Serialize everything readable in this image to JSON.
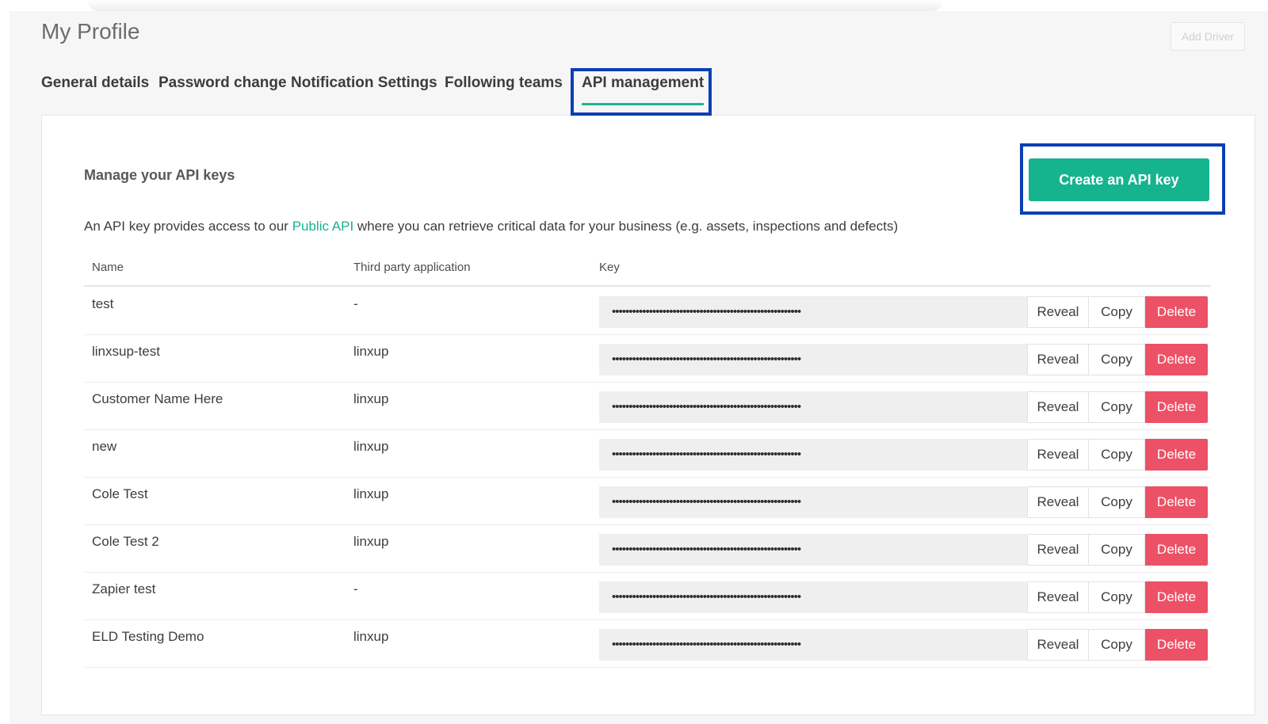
{
  "page": {
    "title": "My Profile",
    "add_driver_label": "Add Driver"
  },
  "tabs": [
    {
      "label": "General details"
    },
    {
      "label": "Password change"
    },
    {
      "label": "Notification Settings"
    },
    {
      "label": "Following teams"
    },
    {
      "label": "API management",
      "active": true
    }
  ],
  "api": {
    "section_title": "Manage your API keys",
    "create_button_label": "Create an API key",
    "description_prefix": "An API key provides access to our ",
    "description_link": "Public API",
    "description_suffix": " where you can retrieve critical data for your business (e.g. assets, inspections and defects)",
    "columns": [
      "Name",
      "Third party application",
      "Key"
    ],
    "masked_key": "••••••••••••••••••••••••••••••••••••••••••••••••••••••••",
    "action_labels": {
      "reveal": "Reveal",
      "copy": "Copy",
      "delete": "Delete"
    },
    "rows": [
      {
        "name": "test",
        "app": "-"
      },
      {
        "name": "linxsup-test",
        "app": "linxup"
      },
      {
        "name": "Customer Name Here",
        "app": "linxup"
      },
      {
        "name": "new",
        "app": "linxup"
      },
      {
        "name": "Cole Test",
        "app": "linxup"
      },
      {
        "name": "Cole Test 2",
        "app": "linxup"
      },
      {
        "name": "Zapier test",
        "app": "-"
      },
      {
        "name": "ELD Testing Demo",
        "app": "linxup"
      }
    ]
  },
  "colors": {
    "accent": "#16b38f",
    "danger": "#ec5166",
    "highlight": "#0b3fb3"
  }
}
